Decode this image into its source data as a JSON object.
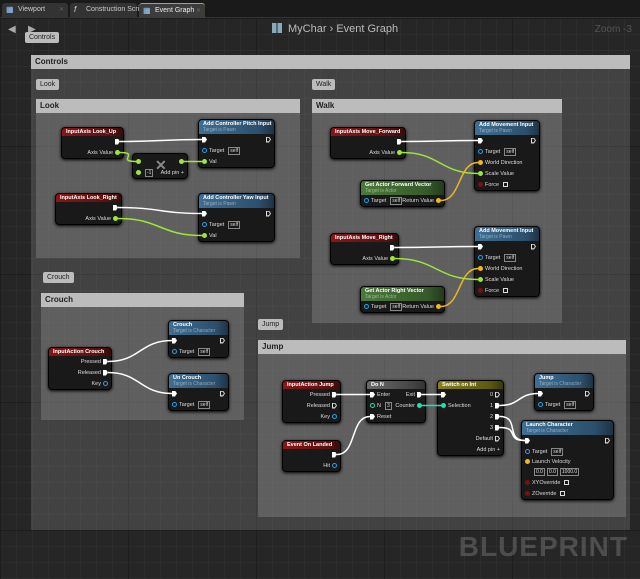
{
  "tabs": [
    {
      "label": "Viewport",
      "icon": "viewport-icon"
    },
    {
      "label": "Construction Script",
      "icon": "function-icon"
    },
    {
      "label": "Event Graph",
      "icon": "graph-icon",
      "active": true
    }
  ],
  "breadcrumb": {
    "root": "MyChar",
    "sep": "›",
    "current": "Event Graph"
  },
  "zoom": "Zoom -3",
  "watermark": "BLUEPRINT",
  "comments": {
    "controls": "Controls",
    "look": "Look",
    "walk": "Walk",
    "crouch": "Crouch",
    "jump": "Jump"
  },
  "nodes": {
    "look_up": {
      "kind": "event",
      "title": "InputAxis Look_Up",
      "rows": [
        [
          null,
          {
            "t": "exec"
          }
        ],
        [
          null,
          {
            "t": "float",
            "label": "Axis Value"
          }
        ]
      ]
    },
    "add_pin": {
      "kind": "compact",
      "title": "",
      "rows": [
        [
          {
            "t": "float"
          },
          {
            "t": "float"
          }
        ],
        [
          {
            "t": "float",
            "def": "-1"
          },
          {
            "t": "none",
            "label": "Add pin +"
          }
        ]
      ]
    },
    "pitch": {
      "kind": "func",
      "title": "Add Controller Pitch Input",
      "sub": "Target is Pawn",
      "rows": [
        [
          {
            "t": "exec"
          },
          {
            "t": "execo"
          }
        ],
        [
          {
            "t": "obj",
            "label": "Target",
            "def": "self"
          },
          null
        ],
        [
          {
            "t": "float",
            "label": "Val"
          },
          null
        ]
      ]
    },
    "look_right": {
      "kind": "event",
      "title": "InputAxis Look_Right",
      "rows": [
        [
          null,
          {
            "t": "exec"
          }
        ],
        [
          null,
          {
            "t": "float",
            "label": "Axis Value"
          }
        ]
      ]
    },
    "yaw": {
      "kind": "func",
      "title": "Add Controller Yaw Input",
      "sub": "Target is Pawn",
      "rows": [
        [
          {
            "t": "exec"
          },
          {
            "t": "execo"
          }
        ],
        [
          {
            "t": "obj",
            "label": "Target",
            "def": "self"
          },
          null
        ],
        [
          {
            "t": "float",
            "label": "Val"
          },
          null
        ]
      ]
    },
    "move_fwd": {
      "kind": "event",
      "title": "InputAxis Move_Forward",
      "rows": [
        [
          null,
          {
            "t": "exec"
          }
        ],
        [
          null,
          {
            "t": "float",
            "label": "Axis Value"
          }
        ]
      ]
    },
    "add_move1": {
      "kind": "func",
      "title": "Add Movement Input",
      "sub": "Target is Pawn",
      "rows": [
        [
          {
            "t": "exec"
          },
          {
            "t": "execo"
          }
        ],
        [
          {
            "t": "obj",
            "label": "Target",
            "def": "self"
          },
          null
        ],
        [
          {
            "t": "vec",
            "label": "World Direction"
          },
          null
        ],
        [
          {
            "t": "float",
            "label": "Scale Value"
          },
          null
        ],
        [
          {
            "t": "bool",
            "label": "Force",
            "chk": true
          },
          null
        ]
      ]
    },
    "get_fwd": {
      "kind": "pure",
      "title": "Get Actor Forward Vector",
      "sub": "Target is Actor",
      "rows": [
        [
          {
            "t": "obj",
            "label": "Target",
            "def": "self"
          },
          {
            "t": "vec",
            "label": "Return Value"
          }
        ]
      ]
    },
    "move_right": {
      "kind": "event",
      "title": "InputAxis Move_Right",
      "rows": [
        [
          null,
          {
            "t": "exec"
          }
        ],
        [
          null,
          {
            "t": "float",
            "label": "Axis Value"
          }
        ]
      ]
    },
    "add_move2": {
      "kind": "func",
      "title": "Add Movement Input",
      "sub": "Target is Pawn",
      "rows": [
        [
          {
            "t": "exec"
          },
          {
            "t": "execo"
          }
        ],
        [
          {
            "t": "obj",
            "label": "Target",
            "def": "self"
          },
          null
        ],
        [
          {
            "t": "vec",
            "label": "World Direction"
          },
          null
        ],
        [
          {
            "t": "float",
            "label": "Scale Value"
          },
          null
        ],
        [
          {
            "t": "bool",
            "label": "Force",
            "chk": true
          },
          null
        ]
      ]
    },
    "get_right": {
      "kind": "pure",
      "title": "Get Actor Right Vector",
      "sub": "Target is Actor",
      "rows": [
        [
          {
            "t": "obj",
            "label": "Target",
            "def": "self"
          },
          {
            "t": "vec",
            "label": "Return Value"
          }
        ]
      ]
    },
    "ia_crouch": {
      "kind": "event",
      "title": "InputAction Crouch",
      "rows": [
        [
          null,
          {
            "t": "exec",
            "label": "Pressed"
          }
        ],
        [
          null,
          {
            "t": "exec",
            "label": "Released"
          }
        ],
        [
          null,
          {
            "t": "obj",
            "label": "Key"
          }
        ]
      ]
    },
    "crouch": {
      "kind": "func",
      "title": "Crouch",
      "sub": "Target is Character",
      "rows": [
        [
          {
            "t": "exec"
          },
          {
            "t": "execo"
          }
        ],
        [
          {
            "t": "obj",
            "label": "Target",
            "def": "self"
          },
          null
        ]
      ]
    },
    "uncrouch": {
      "kind": "func",
      "title": "Un Crouch",
      "sub": "Target is Character",
      "rows": [
        [
          {
            "t": "exec"
          },
          {
            "t": "execo"
          }
        ],
        [
          {
            "t": "obj",
            "label": "Target",
            "def": "self"
          },
          null
        ]
      ]
    },
    "ia_jump": {
      "kind": "event",
      "title": "InputAction Jump",
      "rows": [
        [
          null,
          {
            "t": "exec",
            "label": "Pressed"
          }
        ],
        [
          null,
          {
            "t": "execo",
            "label": "Released"
          }
        ],
        [
          null,
          {
            "t": "obj",
            "label": "Key"
          }
        ]
      ]
    },
    "landed": {
      "kind": "event",
      "title": "Event On Landed",
      "rows": [
        [
          null,
          {
            "t": "exec"
          }
        ],
        [
          null,
          {
            "t": "obj",
            "label": "Hit"
          }
        ]
      ]
    },
    "do_n": {
      "kind": "flow",
      "title": "Do N",
      "rows": [
        [
          {
            "t": "exec",
            "label": "Enter"
          },
          {
            "t": "exec",
            "label": "Exit"
          }
        ],
        [
          {
            "t": "into",
            "label": "N",
            "def": "3"
          },
          {
            "t": "int",
            "label": "Counter"
          }
        ],
        [
          {
            "t": "exec",
            "label": "Reset"
          },
          null
        ]
      ]
    },
    "switch": {
      "kind": "switch",
      "title": "Switch on Int",
      "rows": [
        [
          {
            "t": "exec"
          },
          {
            "t": "execo",
            "label": "0"
          }
        ],
        [
          {
            "t": "int",
            "label": "Selection"
          },
          {
            "t": "exec",
            "label": "1"
          }
        ],
        [
          null,
          {
            "t": "exec",
            "label": "2"
          }
        ],
        [
          null,
          {
            "t": "exec",
            "label": "3"
          }
        ],
        [
          null,
          {
            "t": "execo",
            "label": "Default"
          }
        ],
        [
          null,
          {
            "t": "none",
            "label": "Add pin +"
          }
        ]
      ]
    },
    "jump": {
      "kind": "func",
      "title": "Jump",
      "sub": "Target is Character",
      "rows": [
        [
          {
            "t": "exec"
          },
          {
            "t": "execo"
          }
        ],
        [
          {
            "t": "obj",
            "label": "Target",
            "def": "self"
          },
          null
        ]
      ]
    },
    "launch": {
      "kind": "func",
      "title": "Launch Character",
      "sub": "Target is Character",
      "rows": [
        [
          {
            "t": "exec"
          },
          {
            "t": "execo"
          }
        ],
        [
          {
            "t": "obj",
            "label": "Target",
            "def": "self"
          },
          null
        ],
        [
          {
            "t": "vecv",
            "label": "Launch Velocity",
            "defs": [
              "0.0",
              "0.0",
              "1000.0"
            ]
          },
          null
        ],
        [
          {
            "t": "bool",
            "label": "XYOverride",
            "chk": true
          },
          null
        ],
        [
          {
            "t": "bool",
            "label": "ZOverride",
            "chk": true
          },
          null
        ]
      ]
    }
  }
}
